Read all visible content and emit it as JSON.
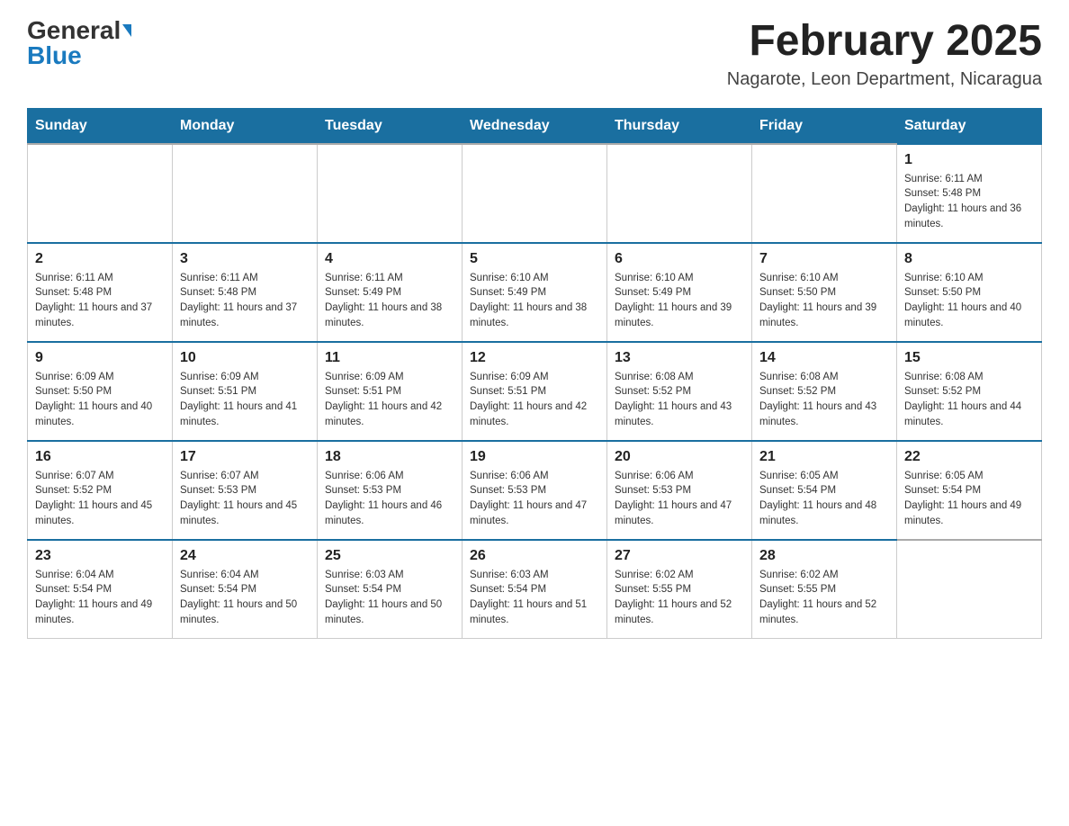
{
  "logo": {
    "general": "General",
    "blue": "Blue"
  },
  "header": {
    "month_year": "February 2025",
    "location": "Nagarote, Leon Department, Nicaragua"
  },
  "weekdays": [
    "Sunday",
    "Monday",
    "Tuesday",
    "Wednesday",
    "Thursday",
    "Friday",
    "Saturday"
  ],
  "weeks": [
    [
      {
        "day": "",
        "sunrise": "",
        "sunset": "",
        "daylight": ""
      },
      {
        "day": "",
        "sunrise": "",
        "sunset": "",
        "daylight": ""
      },
      {
        "day": "",
        "sunrise": "",
        "sunset": "",
        "daylight": ""
      },
      {
        "day": "",
        "sunrise": "",
        "sunset": "",
        "daylight": ""
      },
      {
        "day": "",
        "sunrise": "",
        "sunset": "",
        "daylight": ""
      },
      {
        "day": "",
        "sunrise": "",
        "sunset": "",
        "daylight": ""
      },
      {
        "day": "1",
        "sunrise": "Sunrise: 6:11 AM",
        "sunset": "Sunset: 5:48 PM",
        "daylight": "Daylight: 11 hours and 36 minutes."
      }
    ],
    [
      {
        "day": "2",
        "sunrise": "Sunrise: 6:11 AM",
        "sunset": "Sunset: 5:48 PM",
        "daylight": "Daylight: 11 hours and 37 minutes."
      },
      {
        "day": "3",
        "sunrise": "Sunrise: 6:11 AM",
        "sunset": "Sunset: 5:48 PM",
        "daylight": "Daylight: 11 hours and 37 minutes."
      },
      {
        "day": "4",
        "sunrise": "Sunrise: 6:11 AM",
        "sunset": "Sunset: 5:49 PM",
        "daylight": "Daylight: 11 hours and 38 minutes."
      },
      {
        "day": "5",
        "sunrise": "Sunrise: 6:10 AM",
        "sunset": "Sunset: 5:49 PM",
        "daylight": "Daylight: 11 hours and 38 minutes."
      },
      {
        "day": "6",
        "sunrise": "Sunrise: 6:10 AM",
        "sunset": "Sunset: 5:49 PM",
        "daylight": "Daylight: 11 hours and 39 minutes."
      },
      {
        "day": "7",
        "sunrise": "Sunrise: 6:10 AM",
        "sunset": "Sunset: 5:50 PM",
        "daylight": "Daylight: 11 hours and 39 minutes."
      },
      {
        "day": "8",
        "sunrise": "Sunrise: 6:10 AM",
        "sunset": "Sunset: 5:50 PM",
        "daylight": "Daylight: 11 hours and 40 minutes."
      }
    ],
    [
      {
        "day": "9",
        "sunrise": "Sunrise: 6:09 AM",
        "sunset": "Sunset: 5:50 PM",
        "daylight": "Daylight: 11 hours and 40 minutes."
      },
      {
        "day": "10",
        "sunrise": "Sunrise: 6:09 AM",
        "sunset": "Sunset: 5:51 PM",
        "daylight": "Daylight: 11 hours and 41 minutes."
      },
      {
        "day": "11",
        "sunrise": "Sunrise: 6:09 AM",
        "sunset": "Sunset: 5:51 PM",
        "daylight": "Daylight: 11 hours and 42 minutes."
      },
      {
        "day": "12",
        "sunrise": "Sunrise: 6:09 AM",
        "sunset": "Sunset: 5:51 PM",
        "daylight": "Daylight: 11 hours and 42 minutes."
      },
      {
        "day": "13",
        "sunrise": "Sunrise: 6:08 AM",
        "sunset": "Sunset: 5:52 PM",
        "daylight": "Daylight: 11 hours and 43 minutes."
      },
      {
        "day": "14",
        "sunrise": "Sunrise: 6:08 AM",
        "sunset": "Sunset: 5:52 PM",
        "daylight": "Daylight: 11 hours and 43 minutes."
      },
      {
        "day": "15",
        "sunrise": "Sunrise: 6:08 AM",
        "sunset": "Sunset: 5:52 PM",
        "daylight": "Daylight: 11 hours and 44 minutes."
      }
    ],
    [
      {
        "day": "16",
        "sunrise": "Sunrise: 6:07 AM",
        "sunset": "Sunset: 5:52 PM",
        "daylight": "Daylight: 11 hours and 45 minutes."
      },
      {
        "day": "17",
        "sunrise": "Sunrise: 6:07 AM",
        "sunset": "Sunset: 5:53 PM",
        "daylight": "Daylight: 11 hours and 45 minutes."
      },
      {
        "day": "18",
        "sunrise": "Sunrise: 6:06 AM",
        "sunset": "Sunset: 5:53 PM",
        "daylight": "Daylight: 11 hours and 46 minutes."
      },
      {
        "day": "19",
        "sunrise": "Sunrise: 6:06 AM",
        "sunset": "Sunset: 5:53 PM",
        "daylight": "Daylight: 11 hours and 47 minutes."
      },
      {
        "day": "20",
        "sunrise": "Sunrise: 6:06 AM",
        "sunset": "Sunset: 5:53 PM",
        "daylight": "Daylight: 11 hours and 47 minutes."
      },
      {
        "day": "21",
        "sunrise": "Sunrise: 6:05 AM",
        "sunset": "Sunset: 5:54 PM",
        "daylight": "Daylight: 11 hours and 48 minutes."
      },
      {
        "day": "22",
        "sunrise": "Sunrise: 6:05 AM",
        "sunset": "Sunset: 5:54 PM",
        "daylight": "Daylight: 11 hours and 49 minutes."
      }
    ],
    [
      {
        "day": "23",
        "sunrise": "Sunrise: 6:04 AM",
        "sunset": "Sunset: 5:54 PM",
        "daylight": "Daylight: 11 hours and 49 minutes."
      },
      {
        "day": "24",
        "sunrise": "Sunrise: 6:04 AM",
        "sunset": "Sunset: 5:54 PM",
        "daylight": "Daylight: 11 hours and 50 minutes."
      },
      {
        "day": "25",
        "sunrise": "Sunrise: 6:03 AM",
        "sunset": "Sunset: 5:54 PM",
        "daylight": "Daylight: 11 hours and 50 minutes."
      },
      {
        "day": "26",
        "sunrise": "Sunrise: 6:03 AM",
        "sunset": "Sunset: 5:54 PM",
        "daylight": "Daylight: 11 hours and 51 minutes."
      },
      {
        "day": "27",
        "sunrise": "Sunrise: 6:02 AM",
        "sunset": "Sunset: 5:55 PM",
        "daylight": "Daylight: 11 hours and 52 minutes."
      },
      {
        "day": "28",
        "sunrise": "Sunrise: 6:02 AM",
        "sunset": "Sunset: 5:55 PM",
        "daylight": "Daylight: 11 hours and 52 minutes."
      },
      {
        "day": "",
        "sunrise": "",
        "sunset": "",
        "daylight": ""
      }
    ]
  ]
}
